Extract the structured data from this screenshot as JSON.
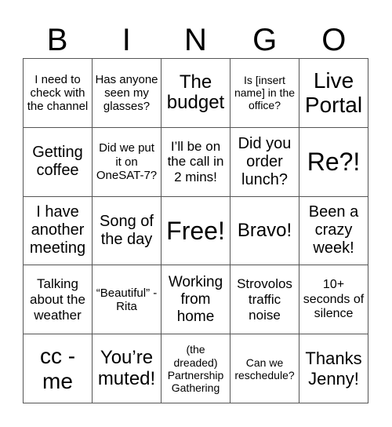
{
  "header": {
    "letters": [
      "B",
      "I",
      "N",
      "G",
      "O"
    ]
  },
  "cells": [
    [
      "I need to check with the channel",
      "Has anyone seen my glasses?",
      "The budget",
      "Is [insert name] in the office?",
      "Live Portal"
    ],
    [
      "Getting coffee",
      "Did we put it on OneSAT-7?",
      "I’ll be on the call in 2 mins!",
      "Did you order lunch?",
      "Re?!"
    ],
    [
      "I have another meeting",
      "Song of the day",
      "Free!",
      "Bravo!",
      "Been a crazy week!"
    ],
    [
      "Talking about the weather",
      "“Beautiful” - Rita",
      "Working from home",
      "Strovolos traffic noise",
      "10+ seconds of silence"
    ],
    [
      "cc - me",
      "You’re muted!",
      "(the dreaded) Partnership Gathering",
      "Can we reschedule?",
      "Thanks Jenny!"
    ]
  ]
}
